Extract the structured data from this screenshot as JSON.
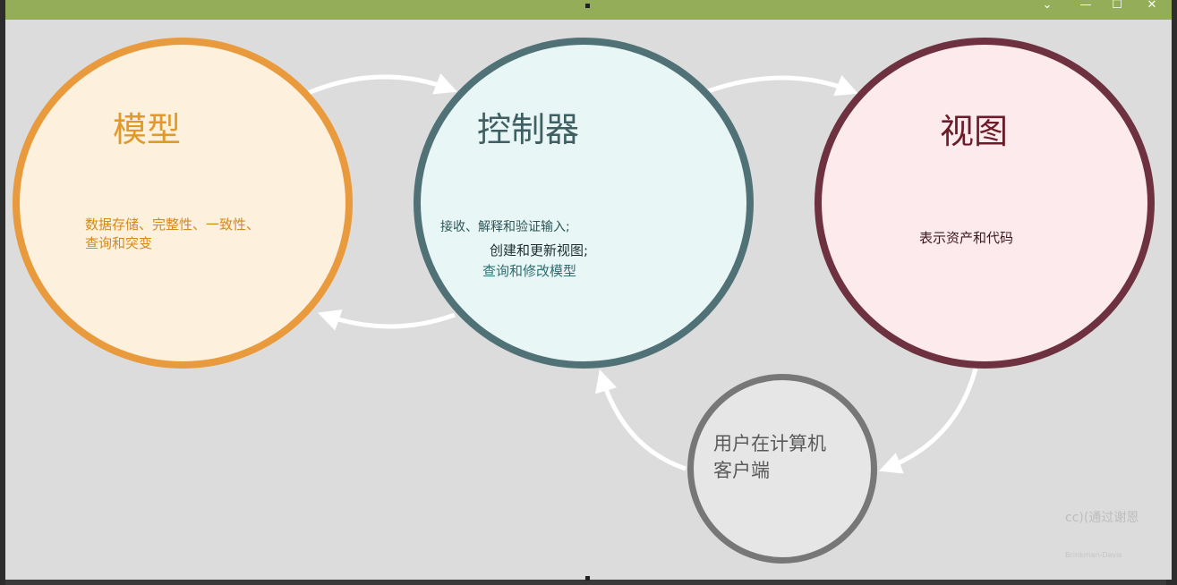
{
  "window": {
    "controls": {
      "minimize": "—",
      "maximize": "☐",
      "close": "✕",
      "dropdown": "⌄"
    },
    "titlebar_color": "#93ad58"
  },
  "diagram": {
    "model": {
      "title": "模型",
      "description_line1": "数据存储、完整性、一致性、",
      "description_line2": "查询和突变",
      "color": "#e89a3c",
      "fill": "#fdf0dc"
    },
    "controller": {
      "title": "控制器",
      "line1": "接收、解释和验证输入;",
      "line2": "创建和更新视图;",
      "line3": "查询和修改模型",
      "color": "#507277",
      "fill": "#e8f6f6"
    },
    "view": {
      "title": "视图",
      "description": "表示资产和代码",
      "color": "#6e3140",
      "fill": "#fdeaec"
    },
    "user": {
      "line1": "用户在计算机",
      "line2": "客户端",
      "color": "#777777",
      "fill": "#e6e6e6"
    },
    "watermark": {
      "text": "cc)(通过谢恩",
      "author": "Brinkman-Davis"
    }
  }
}
